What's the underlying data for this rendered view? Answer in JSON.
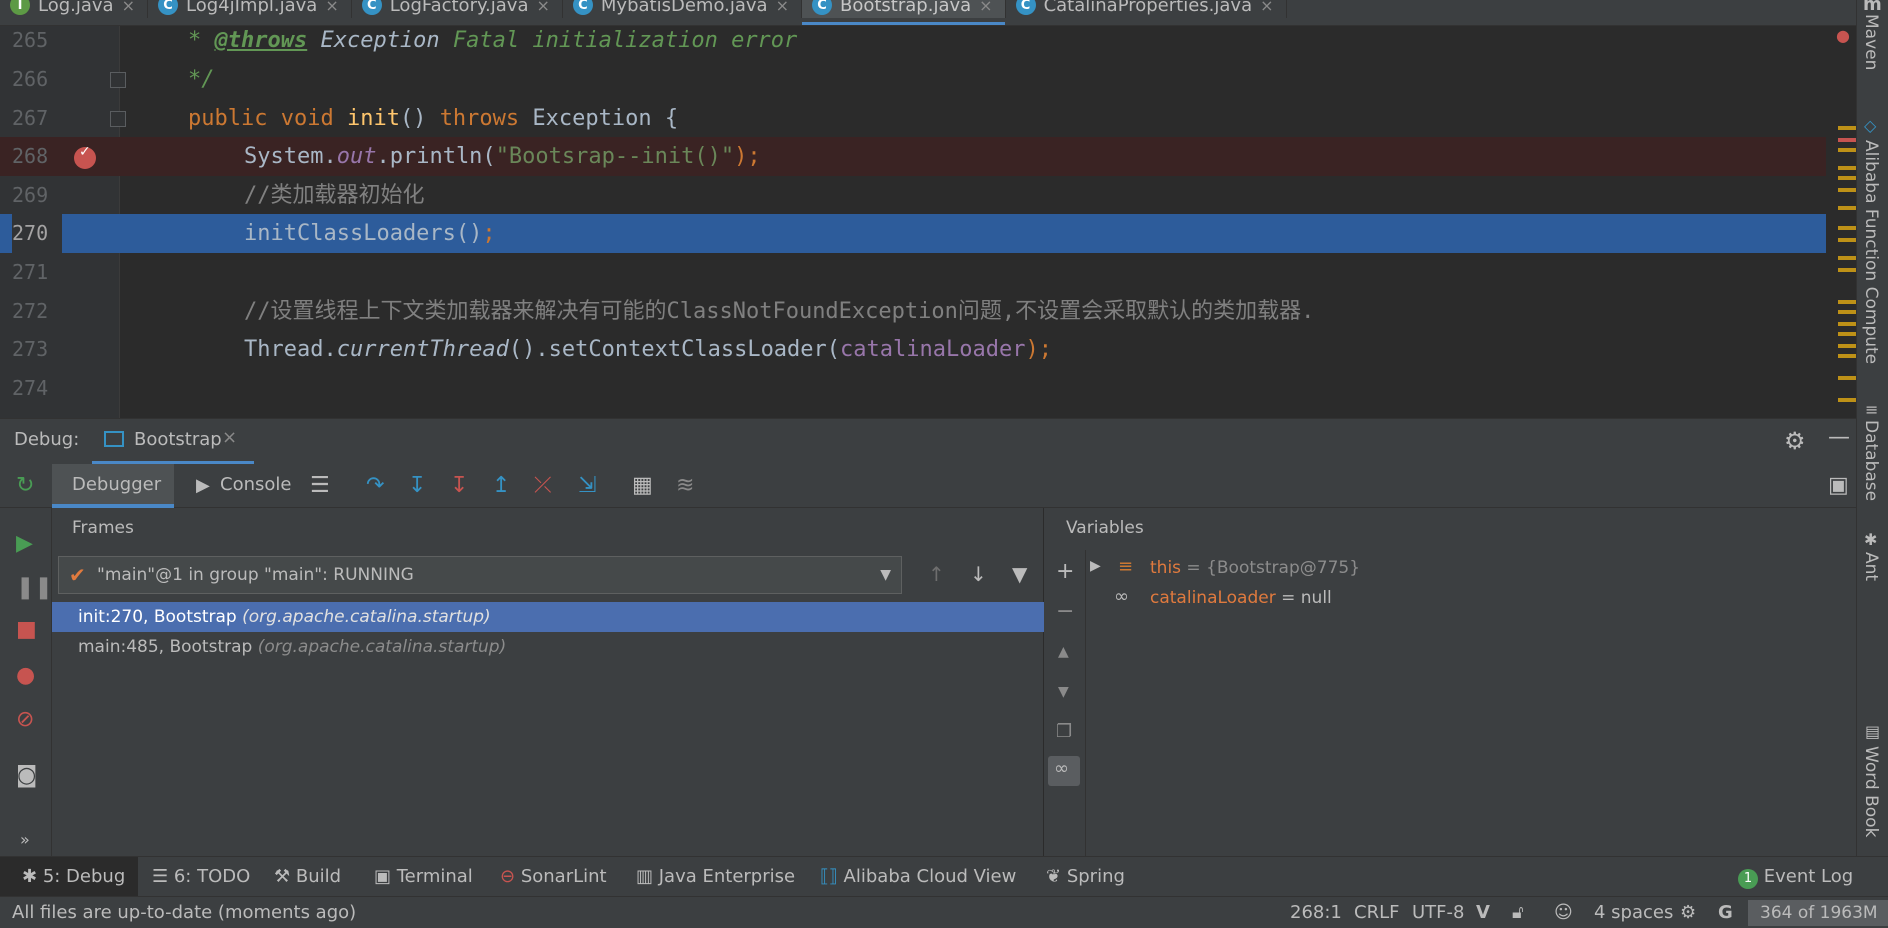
{
  "tabs": [
    {
      "label": "Log.java",
      "icon": "I"
    },
    {
      "label": "Log4jImpl.java",
      "icon": "C"
    },
    {
      "label": "LogFactory.java",
      "icon": "C"
    },
    {
      "label": "MybatisDemo.java",
      "icon": "C"
    },
    {
      "label": "Bootstrap.java",
      "icon": "C"
    },
    {
      "label": "CatalinaProperties.java",
      "icon": "C"
    }
  ],
  "editor": {
    "lines": [
      {
        "num": "265",
        "parts": [
          "* ",
          "@throws",
          " Exception ",
          "Fatal initialization error"
        ]
      },
      {
        "num": "266",
        "parts": [
          "*/"
        ]
      },
      {
        "num": "267",
        "parts": [
          "public void ",
          "init",
          "() ",
          "throws ",
          "Exception {"
        ]
      },
      {
        "num": "268",
        "parts": [
          "System.",
          "out",
          ".println(",
          "\"Bootsrap--init()\"",
          ");"
        ]
      },
      {
        "num": "269",
        "parts": [
          "//类加载器初始化"
        ]
      },
      {
        "num": "270",
        "parts": [
          "initClassLoaders()",
          ";"
        ]
      },
      {
        "num": "271",
        "parts": []
      },
      {
        "num": "272",
        "parts": [
          "//设置线程上下文类加载器来解决有可能的ClassNotFoundException问题,不设置会采取默认的类加载器."
        ]
      },
      {
        "num": "273",
        "parts": [
          "Thread.",
          "currentThread",
          "().setContextClassLoader(",
          "catalinaLoader",
          ");"
        ]
      },
      {
        "num": "274",
        "parts": []
      }
    ]
  },
  "right_tools": [
    "Maven",
    "Alibaba Function Compute",
    "Database",
    "Ant",
    "Word Book"
  ],
  "debug": {
    "title": "Debug:",
    "config_tab": "Bootstrap",
    "tabs": {
      "debugger": "Debugger",
      "console": "Console"
    },
    "frames_title": "Frames",
    "variables_title": "Variables",
    "thread": "\"main\"@1 in group \"main\": RUNNING",
    "frames": [
      {
        "method": "init:270, Bootstrap",
        "pkg": "(org.apache.catalina.startup)"
      },
      {
        "method": "main:485, Bootstrap",
        "pkg": "(org.apache.catalina.startup)"
      }
    ],
    "variables": [
      {
        "name": "this",
        "value": " = {Bootstrap@775}"
      },
      {
        "name": "catalinaLoader",
        "value": " = null"
      }
    ]
  },
  "toolwindows": [
    {
      "label": "5: Debug",
      "icon": "bug-icon"
    },
    {
      "label": "6: TODO",
      "icon": "list-icon"
    },
    {
      "label": "Build",
      "icon": "hammer-icon"
    },
    {
      "label": "Terminal",
      "icon": "terminal-icon"
    },
    {
      "label": "SonarLint",
      "icon": "sonarlint-icon"
    },
    {
      "label": "Java Enterprise",
      "icon": "java-enterprise-icon"
    },
    {
      "label": "Alibaba Cloud View",
      "icon": "cloud-icon"
    },
    {
      "label": "Spring",
      "icon": "spring-icon"
    },
    {
      "label": "Event Log",
      "badge": "1"
    }
  ],
  "status": {
    "message": "All files are up-to-date (moments ago)",
    "position": "268:1",
    "line_sep": "CRLF",
    "encoding": "UTF-8",
    "indent": "4 spaces",
    "memory": "364 of 1963M"
  },
  "colors": {
    "accent": "#4a88c7",
    "breakpoint": "#c75450",
    "selection": "#2d5c9b",
    "frame_selection": "#4b6eaf"
  }
}
